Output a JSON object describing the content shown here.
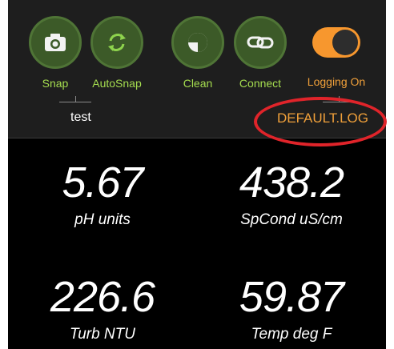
{
  "toolbar": {
    "buttons": [
      {
        "label": "Snap",
        "icon": "camera-icon"
      },
      {
        "label": "AutoSnap",
        "icon": "refresh-icon"
      },
      {
        "label": "Clean",
        "icon": "wiper-icon"
      },
      {
        "label": "Connect",
        "icon": "link-icon"
      }
    ],
    "logging": {
      "label": "Logging On",
      "enabled": true
    }
  },
  "session": {
    "name": "test",
    "logfile": "DEFAULT.LOG"
  },
  "readings": [
    {
      "value": "5.67",
      "unit": "pH units"
    },
    {
      "value": "438.2",
      "unit": "SpCond uS/cm"
    },
    {
      "value": "226.6",
      "unit": "Turb NTU"
    },
    {
      "value": "59.87",
      "unit": "Temp deg F"
    }
  ],
  "colors": {
    "background": "#000000",
    "toolbar": "#1e1e1e",
    "button_fill": "#3c5a28",
    "button_label": "#a5dd4f",
    "toggle": "#f7972e",
    "logfile_text": "#f0a03a",
    "highlight": "#e0242a"
  }
}
